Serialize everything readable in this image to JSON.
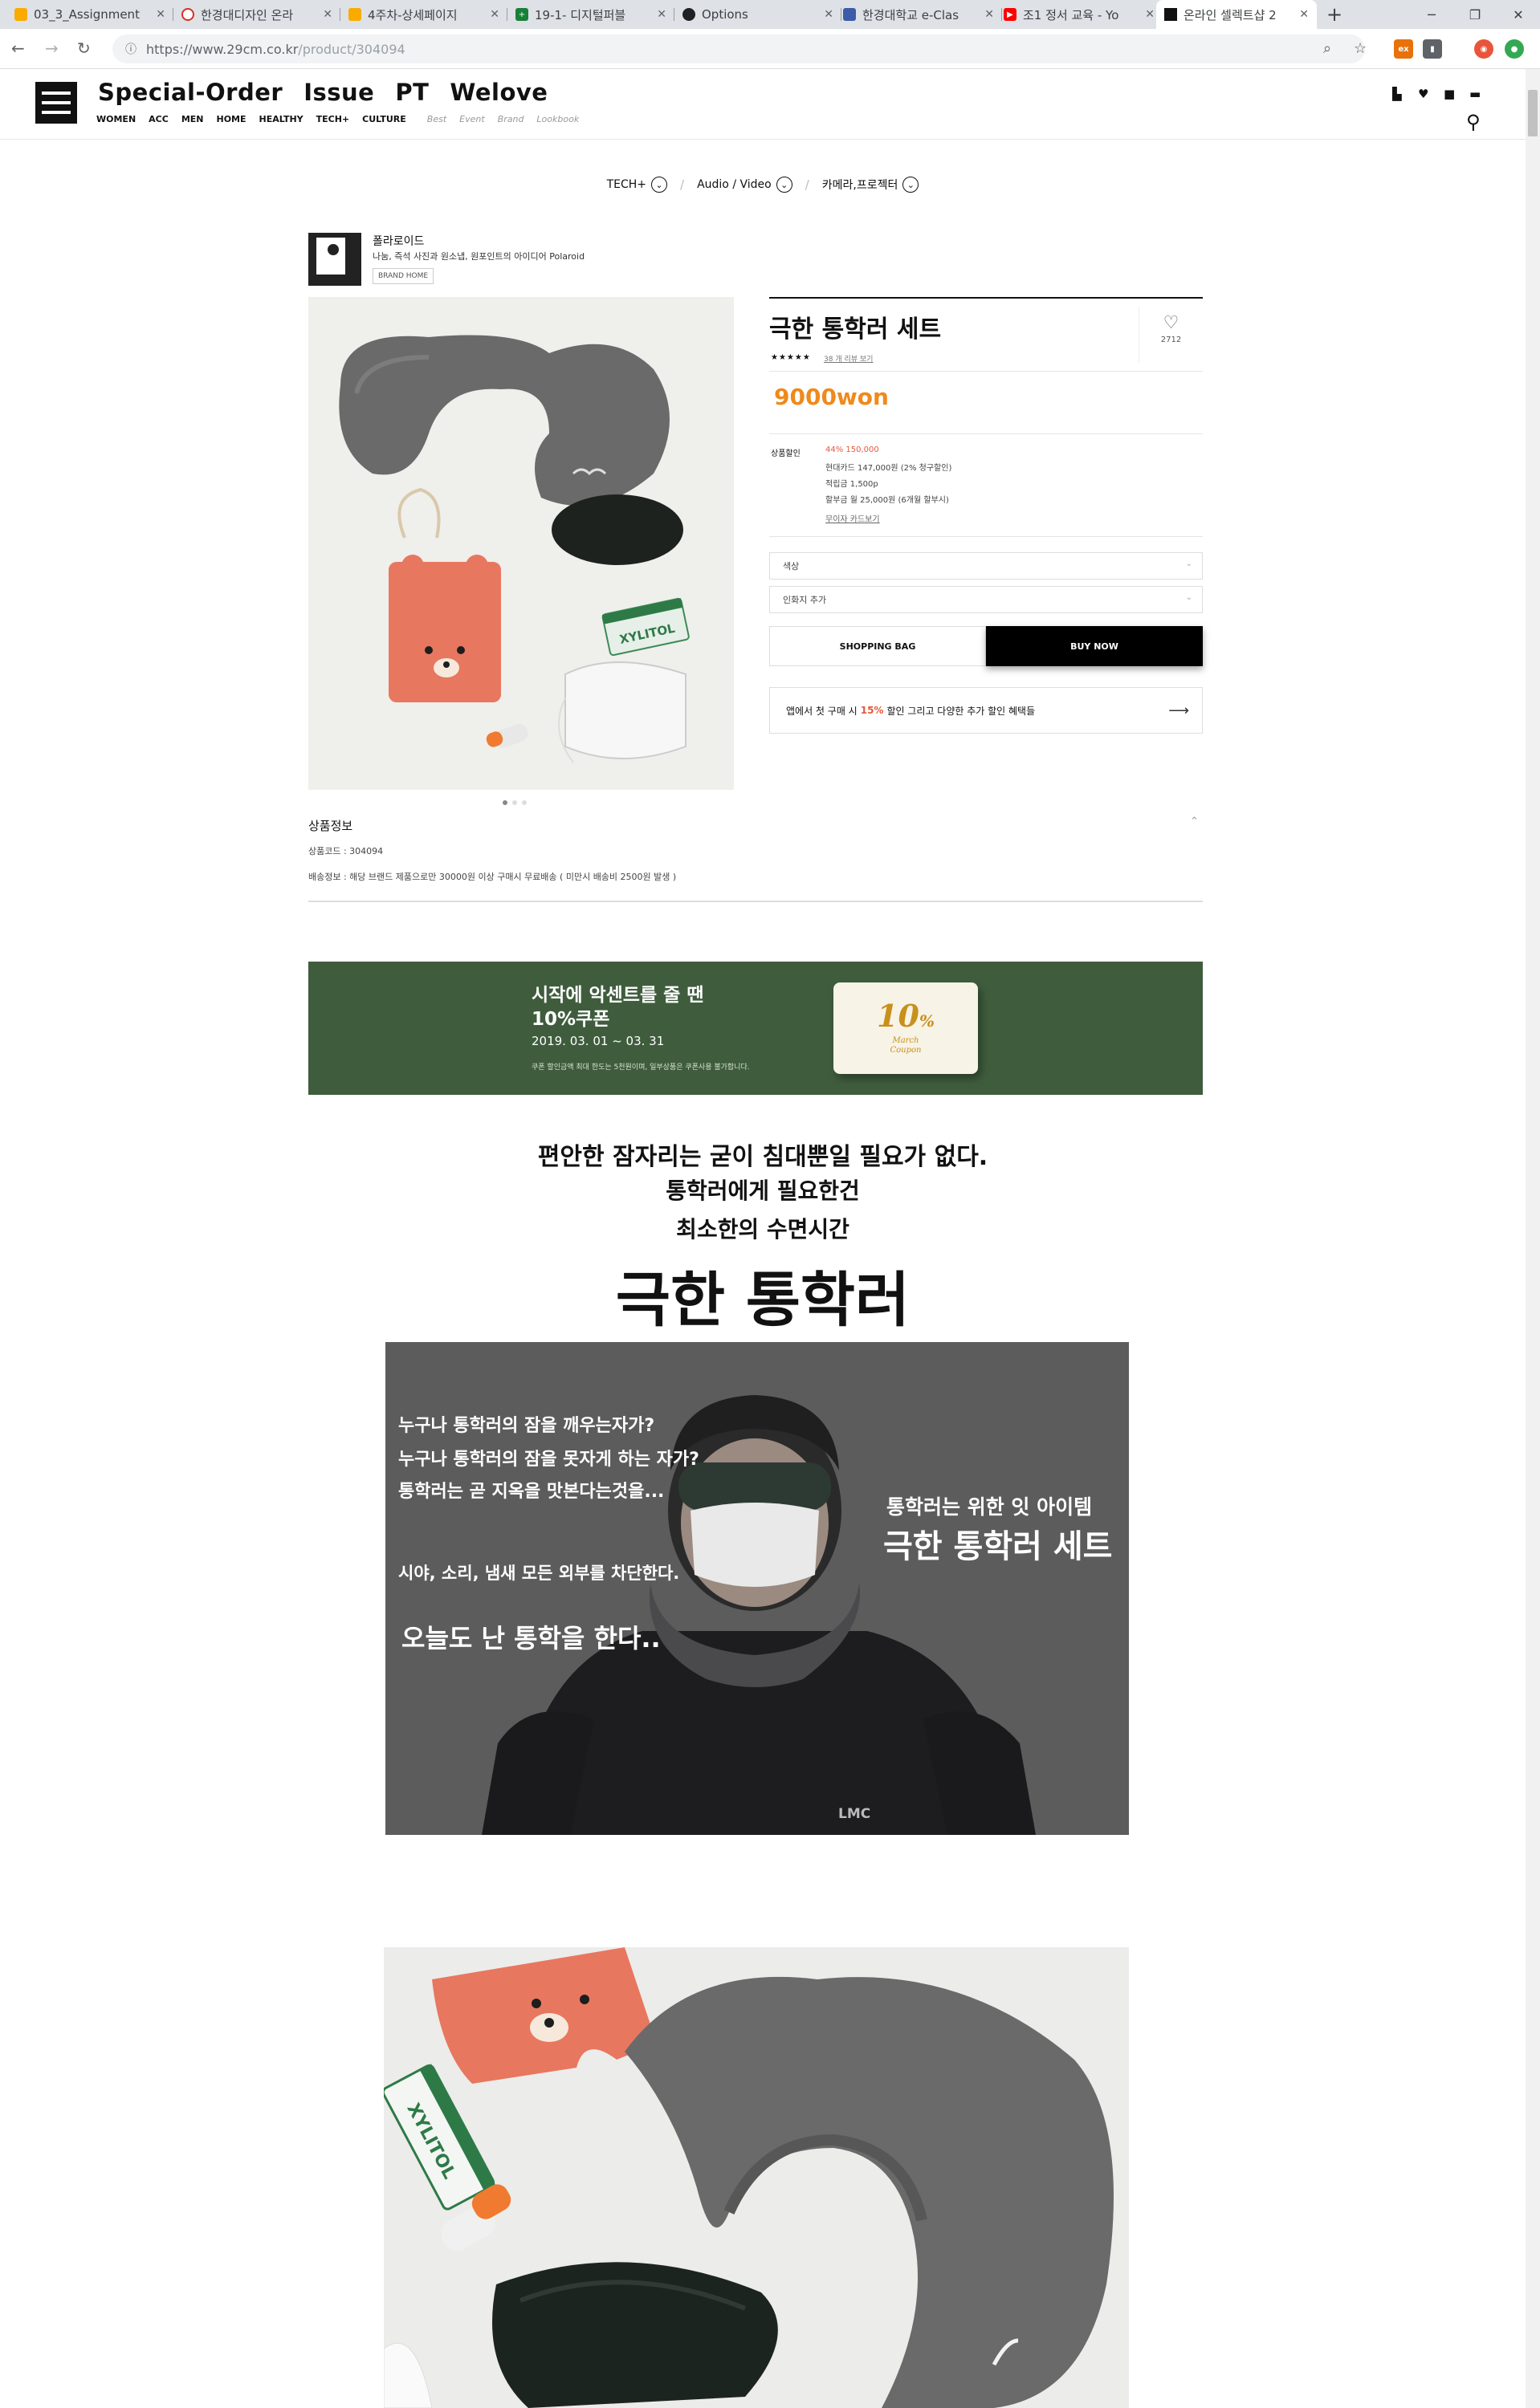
{
  "browser": {
    "tabs": [
      {
        "title": "03_3_Assignment",
        "color": "#f9ab00"
      },
      {
        "title": "한경대디자인 온라",
        "color": "#d93025"
      },
      {
        "title": "4주차-상세페이지",
        "color": "#f9ab00"
      },
      {
        "title": "19-1- 디지털퍼블",
        "color": "#188038"
      },
      {
        "title": "Options",
        "color": "#202124"
      },
      {
        "title": "한경대학교 e-Clas",
        "color": "#3c5ba9"
      },
      {
        "title": "조1 정서 교육 - Yo",
        "color": "#ff0000"
      },
      {
        "title": "온라인 셀렉트샵 2",
        "color": "#111111"
      }
    ],
    "new_tab": "+",
    "url_prefix": "https://www.29cm.co.kr",
    "url_path": "/product/304094"
  },
  "site": {
    "menu": [
      "Special-Order",
      "Issue",
      "PT",
      "Welove"
    ],
    "submenu": [
      "WOMEN",
      "ACC",
      "MEN",
      "HOME",
      "HEALTHY",
      "TECH+",
      "CULTURE"
    ],
    "submenu_italic": [
      "Best",
      "Event",
      "Brand",
      "Lookbook"
    ]
  },
  "breadcrumb": [
    "TECH+",
    "Audio / Video",
    "카메라,프로젝터"
  ],
  "brand": {
    "name": "폴라로이드",
    "desc": "나눔, 즉석 사진과 원소냅, 원포인트의 아이디어 Polaroid",
    "home_button": "BRAND HOME"
  },
  "product": {
    "title": "극한 통학러 세트",
    "likes": "2712",
    "stars": "★★★★★",
    "reviews": "38 개 리뷰 보기",
    "price": "9000won",
    "discount_label": "상품할인",
    "discount_lines": [
      {
        "text": "44% 150,000",
        "style": "red"
      },
      {
        "text": "현대카드 147,000원 (2% 청구할인)",
        "style": ""
      },
      {
        "text": "적립금 1,500p",
        "style": ""
      },
      {
        "text": "할부금 월 25,000원 (6개월 할부시)",
        "style": ""
      },
      {
        "text": "무이자 카드보기",
        "style": "link"
      }
    ],
    "options": [
      "색상",
      "인화지 추가"
    ],
    "shopping_bag": "SHOPPING BAG",
    "buy_now": "BUY NOW",
    "app_banner_before": "앱에서 첫 구매 시",
    "app_banner_percent": "15%",
    "app_banner_after": "할인 그리고 다양한 추가 할인 혜택들",
    "app_banner_arrow": "⟶"
  },
  "product_info": {
    "title": "상품정보",
    "code": "상품코드 : 304094",
    "shipping": "배송정보 : 해당 브랜드 제품으로만 30000원 이상 구매시 무료배송 ( 미만시 배송비 2500원 발생 )"
  },
  "coupon": {
    "line1": "시작에 악센트를 줄 땐",
    "line2": "10%쿠폰",
    "dates": "2019. 03. 01 ~ 03. 31",
    "note": "쿠폰 할인금액 최대 한도는 5천원이며, 일부상품은 쿠폰사용 불가합니다.",
    "card_big": "10",
    "card_pct": "%",
    "card_small_1": "March",
    "card_small_2": "Coupon"
  },
  "headline": {
    "l1": "편안한 잠자리는 굳이 침대뿐일 필요가 없다.",
    "l2": "통학러에게 필요한건",
    "l3": "최소한의 수면시간",
    "big": "극한 통학러"
  },
  "photo_text": {
    "q1": "누구나 통학러의 잠을 깨우는자가?",
    "q2": "누구나 통학러의 잠을 못자게 하는 자가?",
    "q3": "통학러는 곧 지옥을 맛본다는것을...",
    "block": "시야, 소리, 냄새 모든 외부를 차단한다.",
    "today": "오늘도 난 통학을 한다..",
    "right1": "통학러는 위한 잇 아이템",
    "right2": "극한 통학러 세트",
    "jacket": "LMC"
  },
  "gum_label": "XYLITOL",
  "colors": {
    "price": "#ef8a1c",
    "coupon_bg": "#3f5d3d",
    "accent_red": "#e15a3c",
    "bear_orange": "#e8775f",
    "pillow_gray": "#6c6c6c"
  }
}
